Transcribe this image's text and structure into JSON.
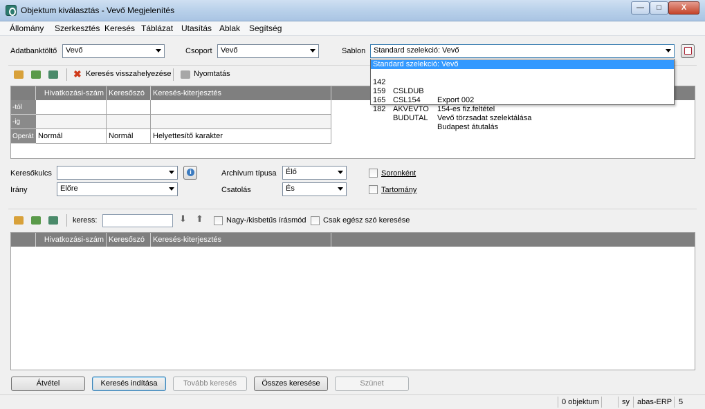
{
  "window": {
    "title": "Objektum kiválasztás - Vevő Megjelenítés",
    "minimize": "—",
    "maximize": "□",
    "close": "X"
  },
  "menu": [
    "Állomány",
    "Szerkesztés",
    "Keresés",
    "Táblázat",
    "Utasítás",
    "Ablak",
    "Segítség"
  ],
  "filters": {
    "adatbanktolto_label": "Adatbanktöltő",
    "adatbanktolto_value": "Vevő",
    "csoport_label": "Csoport",
    "csoport_value": "Vevő",
    "sablon_label": "Sablon",
    "sablon_value": "Standard szelekció: Vevő"
  },
  "toolbar1": {
    "reset_label": "Keresés visszahelyezése",
    "print_label": "Nyomtatás"
  },
  "criteria_grid": {
    "columns": [
      "Hivatkozási-szám",
      "Keresőszó",
      "Keresés-kiterjesztés"
    ],
    "rows": [
      {
        "header": "-tól",
        "cells": [
          "",
          "",
          ""
        ]
      },
      {
        "header": "-ig",
        "cells": [
          "",
          "",
          ""
        ]
      },
      {
        "header": "Operát",
        "cells": [
          "Normál",
          "Normál",
          "Helyettesítő karakter"
        ]
      }
    ]
  },
  "options": {
    "kereskulcs_label": "Keresőkulcs",
    "kereskulcs_value": "",
    "irany_label": "Irány",
    "irany_value": "Előre",
    "archivum_label": "Archívum típusa",
    "archivum_value": "Élő",
    "csatolas_label": "Csatolás",
    "csatolas_value": "És",
    "soronkent_label": "Soronként",
    "tartomany_label": "Tartomány"
  },
  "toolbar2": {
    "search_label": "keress:",
    "search_value": "",
    "case_label": "Nagy-/kisbetűs írásmód",
    "whole_word_label": "Csak egész szó keresése"
  },
  "results_grid": {
    "columns": [
      "Hivatkozási-szám",
      "Keresőszó",
      "Keresés-kiterjesztés"
    ]
  },
  "sablon_dropdown": {
    "selected": "Standard szelekció: Vevő",
    "options": [
      {
        "code": "142",
        "name": "CSLDUB",
        "desc": "Export 002"
      },
      {
        "code": "159",
        "name": "CSL154",
        "desc": "154-es fiz.feltétel"
      },
      {
        "code": "165",
        "name": "AKVEVTO",
        "desc": "Vevő törzsadat szelektálása"
      },
      {
        "code": "182",
        "name": "BUDUTAL",
        "desc": "Budapest átutalás"
      }
    ]
  },
  "buttons": {
    "atvetel": "Átvétel",
    "kereses_inditasa": "Keresés indítása",
    "tovabb_kereses": "Tovább keresés",
    "osszes_kereses": "Összes keresése",
    "szunet": "Szünet"
  },
  "status": {
    "count": "0 objektum",
    "user": "sy",
    "app": "abas-ERP",
    "num": "5"
  },
  "colors": {
    "accent": "#3399ff",
    "grid_header": "#7f7f7f"
  }
}
